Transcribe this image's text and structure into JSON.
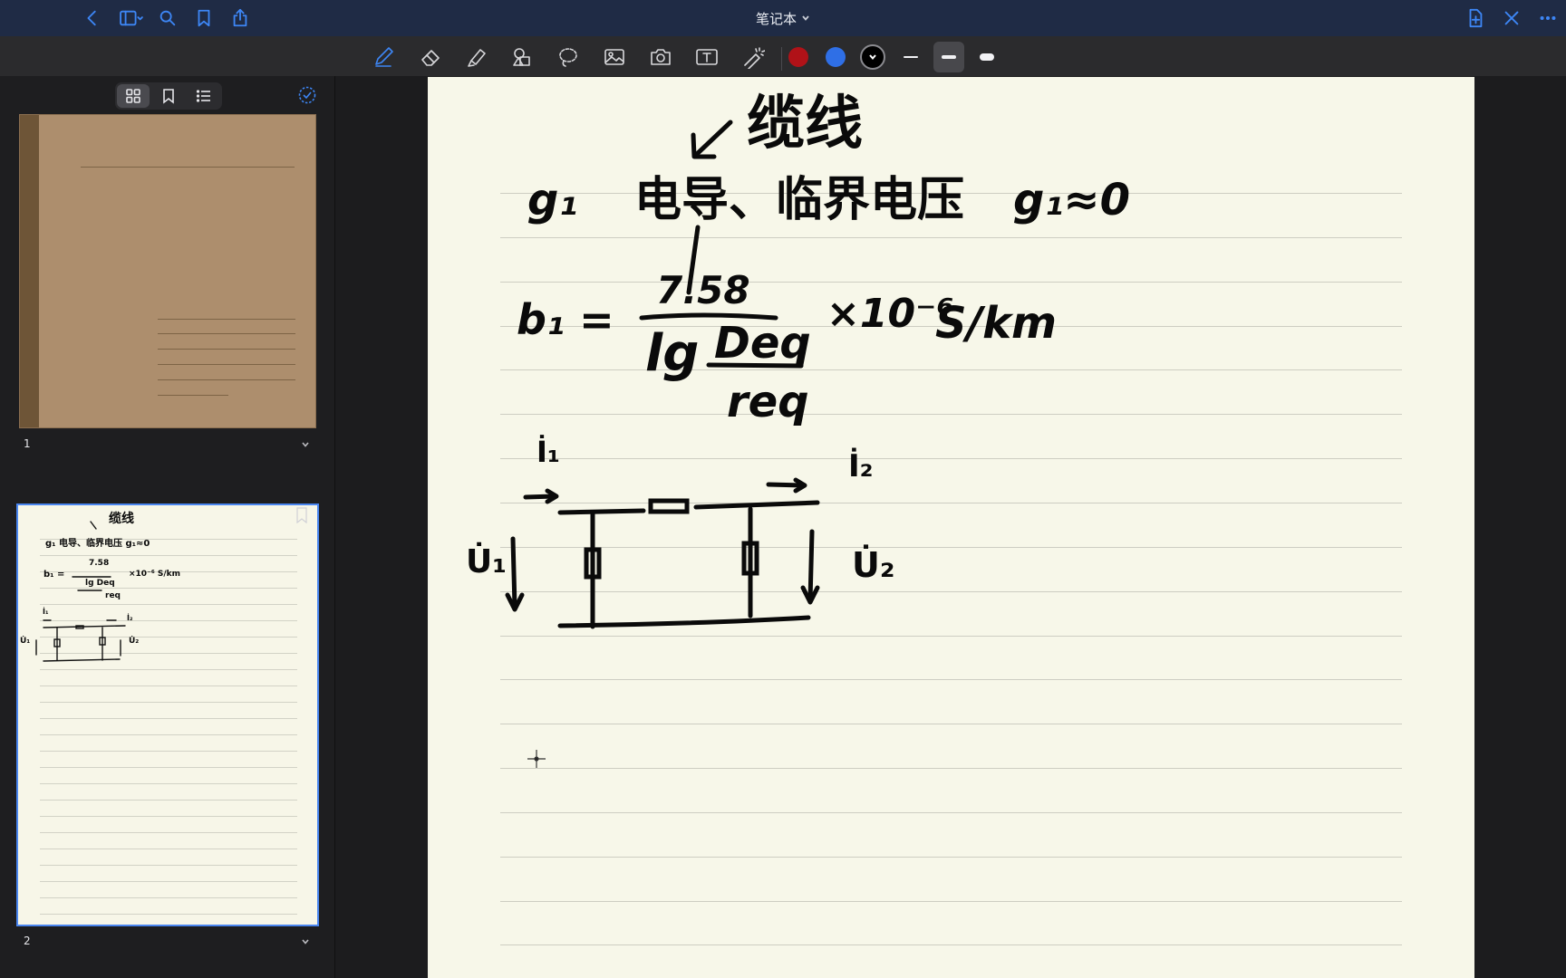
{
  "titlebar": {
    "title": "笔记本",
    "left_icons": [
      "back-chevron-icon",
      "sidebar-toggle-icon",
      "search-icon",
      "bookmark-icon",
      "share-icon"
    ],
    "right_icons": [
      "add-page-icon",
      "close-icon",
      "more-icon"
    ]
  },
  "toolbar": {
    "tools": [
      "pen-icon",
      "eraser-icon",
      "highlighter-icon",
      "shapes-icon",
      "lasso-icon",
      "image-icon",
      "camera-icon",
      "text-icon",
      "laser-pointer-icon"
    ],
    "active_tool": "pen-icon",
    "colors": [
      "#b01218",
      "#2f6fe6",
      "#000000"
    ],
    "selected_color": "#000000",
    "stroke_widths": [
      "thin",
      "medium",
      "thick"
    ],
    "selected_stroke": "medium"
  },
  "sidebar": {
    "view_modes": [
      "grid-view-icon",
      "bookmark-view-icon",
      "outline-view-icon"
    ],
    "active_view": "grid-view-icon",
    "pages": [
      {
        "number": "1",
        "kind": "cover"
      },
      {
        "number": "2",
        "kind": "ruled",
        "selected": true
      }
    ]
  },
  "note": {
    "heading": "缆线",
    "line1_left": "g₁",
    "line1_mid": "电导、临界电压",
    "line1_right": "g₁≈0",
    "b1_label": "b₁ =",
    "numerator": "7.58",
    "denominator_lg": "lg",
    "deq": "Deq",
    "req": "req",
    "factor": "×10⁻⁶",
    "unit": "S/km",
    "i1": "İ₁",
    "i2": "İ₂",
    "u1": "U̇₁",
    "u2": "U̇₂"
  },
  "thumb_note": {
    "heading": "缆线",
    "line1": "g₁  电导、临界电压   g₁≈0",
    "numerator": "7.58",
    "b1_label": "b₁ =",
    "lg_deq": "lg Deq",
    "req": "req",
    "factor_unit": "×10⁻⁶ S/km",
    "i1": "İ₁",
    "i2": "İ₂",
    "u1": "U̇₁",
    "u2": "U̇₂"
  }
}
